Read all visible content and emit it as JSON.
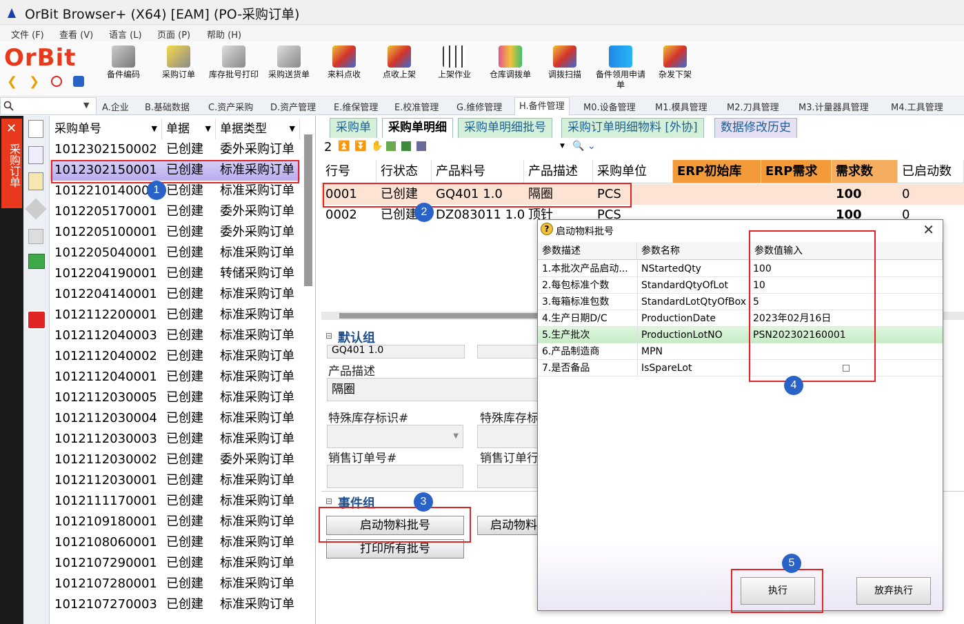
{
  "window": {
    "title": "OrBit Browser+ (X64) [EAM] (PO-采购订单)"
  },
  "menu": [
    "文件 (F)",
    "查看 (V)",
    "语言 (L)",
    "页面 (P)",
    "帮助 (H)"
  ],
  "logo": "OrBit",
  "toolbar": [
    {
      "label": "备件编码",
      "icon": "parts-code-icon"
    },
    {
      "label": "采购订单",
      "icon": "purchase-cart-icon"
    },
    {
      "label": "库存批号打印",
      "icon": "print-lot-icon"
    },
    {
      "label": "采购送货单",
      "icon": "delivery-note-icon"
    },
    {
      "label": "来料点收",
      "icon": "receive-icon"
    },
    {
      "label": "点收上架",
      "icon": "shelve-icon"
    },
    {
      "label": "上架作业",
      "icon": "grid-up-icon"
    },
    {
      "label": "仓库调拨单",
      "icon": "transfer-icon"
    },
    {
      "label": "调拨扫描",
      "icon": "scan-icon"
    },
    {
      "label": "备件领用申请单",
      "icon": "book-icon"
    },
    {
      "label": "杂发下架",
      "icon": "misc-issue-icon"
    }
  ],
  "module_tabs": [
    "A.企业",
    "B.基础数据",
    "C.资产采购",
    "D.资产管理",
    "E.维保管理",
    "E.校准管理",
    "G.维修管理",
    "H.备件管理",
    "M0.设备管理",
    "M1.模具管理",
    "M2.刀具管理",
    "M3.计量器具管理",
    "M4.工具管理"
  ],
  "active_module": "H.备件管理",
  "sidebar": {
    "label": "采购订单"
  },
  "left_list": {
    "headers": [
      "采购单号",
      "单据",
      "单据类型"
    ],
    "rows": [
      [
        "1012302150002",
        "已创建",
        "委外采购订单"
      ],
      [
        "1012302150001",
        "已创建",
        "标准采购订单"
      ],
      [
        "1012210140001",
        "已创建",
        "标准采购订单"
      ],
      [
        "1012205170001",
        "已创建",
        "委外采购订单"
      ],
      [
        "1012205100001",
        "已创建",
        "委外采购订单"
      ],
      [
        "1012205040001",
        "已创建",
        "标准采购订单"
      ],
      [
        "1012204190001",
        "已创建",
        "转储采购订单"
      ],
      [
        "1012204140001",
        "已创建",
        "标准采购订单"
      ],
      [
        "1012112200001",
        "已创建",
        "标准采购订单"
      ],
      [
        "1012112040003",
        "已创建",
        "标准采购订单"
      ],
      [
        "1012112040002",
        "已创建",
        "标准采购订单"
      ],
      [
        "1012112040001",
        "已创建",
        "标准采购订单"
      ],
      [
        "1012112030005",
        "已创建",
        "标准采购订单"
      ],
      [
        "1012112030004",
        "已创建",
        "标准采购订单"
      ],
      [
        "1012112030003",
        "已创建",
        "标准采购订单"
      ],
      [
        "1012112030002",
        "已创建",
        "委外采购订单"
      ],
      [
        "1012112030001",
        "已创建",
        "标准采购订单"
      ],
      [
        "1012111170001",
        "已创建",
        "标准采购订单"
      ],
      [
        "1012109180001",
        "已创建",
        "标准采购订单"
      ],
      [
        "1012108060001",
        "已创建",
        "标准采购订单"
      ],
      [
        "1012107290001",
        "已创建",
        "标准采购订单"
      ],
      [
        "1012107280001",
        "已创建",
        "标准采购订单"
      ],
      [
        "1012107270003",
        "已创建",
        "标准采购订单"
      ]
    ]
  },
  "sub_tabs": [
    "采购单",
    "采购单明细",
    "采购单明细批号",
    "采购订单明细物料 [外协]",
    "数据修改历史"
  ],
  "grid_toolbar": {
    "count": "2"
  },
  "detail_grid": {
    "headers": [
      "行号",
      "行状态",
      "产品料号",
      "产品描述",
      "采购单位",
      "ERP初始库",
      "ERP需求",
      "需求数",
      "已启动数"
    ],
    "rows": [
      [
        "0001",
        "已创建",
        "GQ401 1.0",
        "隔圈",
        "PCS",
        "",
        "",
        "100",
        "0"
      ],
      [
        "0002",
        "已创建",
        "DZ083011 1.0",
        "顶针",
        "PCS",
        "",
        "",
        "100",
        "0"
      ]
    ]
  },
  "default_group": {
    "title": "默认组",
    "partial_value": "GQ401 1.0",
    "product_desc_label": "产品描述",
    "product_desc_value": "隔圈",
    "special_stock_label": "特殊库存标识#",
    "special_stock_label2": "特殊库存标",
    "sales_order_label": "销售订单号#",
    "sales_order_label2": "销售订单行"
  },
  "event_group": {
    "title": "事件组",
    "start_lot_button": "启动物料批号",
    "start_lot_button2": "启动物料",
    "print_all_button": "打印所有批号"
  },
  "dialog": {
    "title": "启动物料批号",
    "headers": [
      "参数描述",
      "参数名称",
      "参数值输入"
    ],
    "rows": [
      [
        "1.本批次产品启动...",
        "NStartedQty",
        "100"
      ],
      [
        "2.每包标准个数",
        "StandardQtyOfLot",
        "10"
      ],
      [
        "3.每箱标准包数",
        "StandardLotQtyOfBox",
        "5"
      ],
      [
        "4.生产日期D/C",
        "ProductionDate",
        "2023年02月16日"
      ],
      [
        "5.生产批次",
        "ProductionLotNO",
        "PSN202302160001"
      ],
      [
        "6.产品制造商",
        "MPN",
        ""
      ],
      [
        "7.是否备品",
        "IsSpareLot",
        ""
      ]
    ],
    "execute_button": "执行",
    "cancel_button": "放弃执行"
  },
  "annotations": [
    "1",
    "2",
    "3",
    "4",
    "5"
  ],
  "colors": {
    "accent_red": "#e02424",
    "badge_blue": "#2a63c8",
    "erp_orange": "#f39a3a",
    "selected_row": "#c6b8f0",
    "highlight_row": "#fde3d3"
  }
}
